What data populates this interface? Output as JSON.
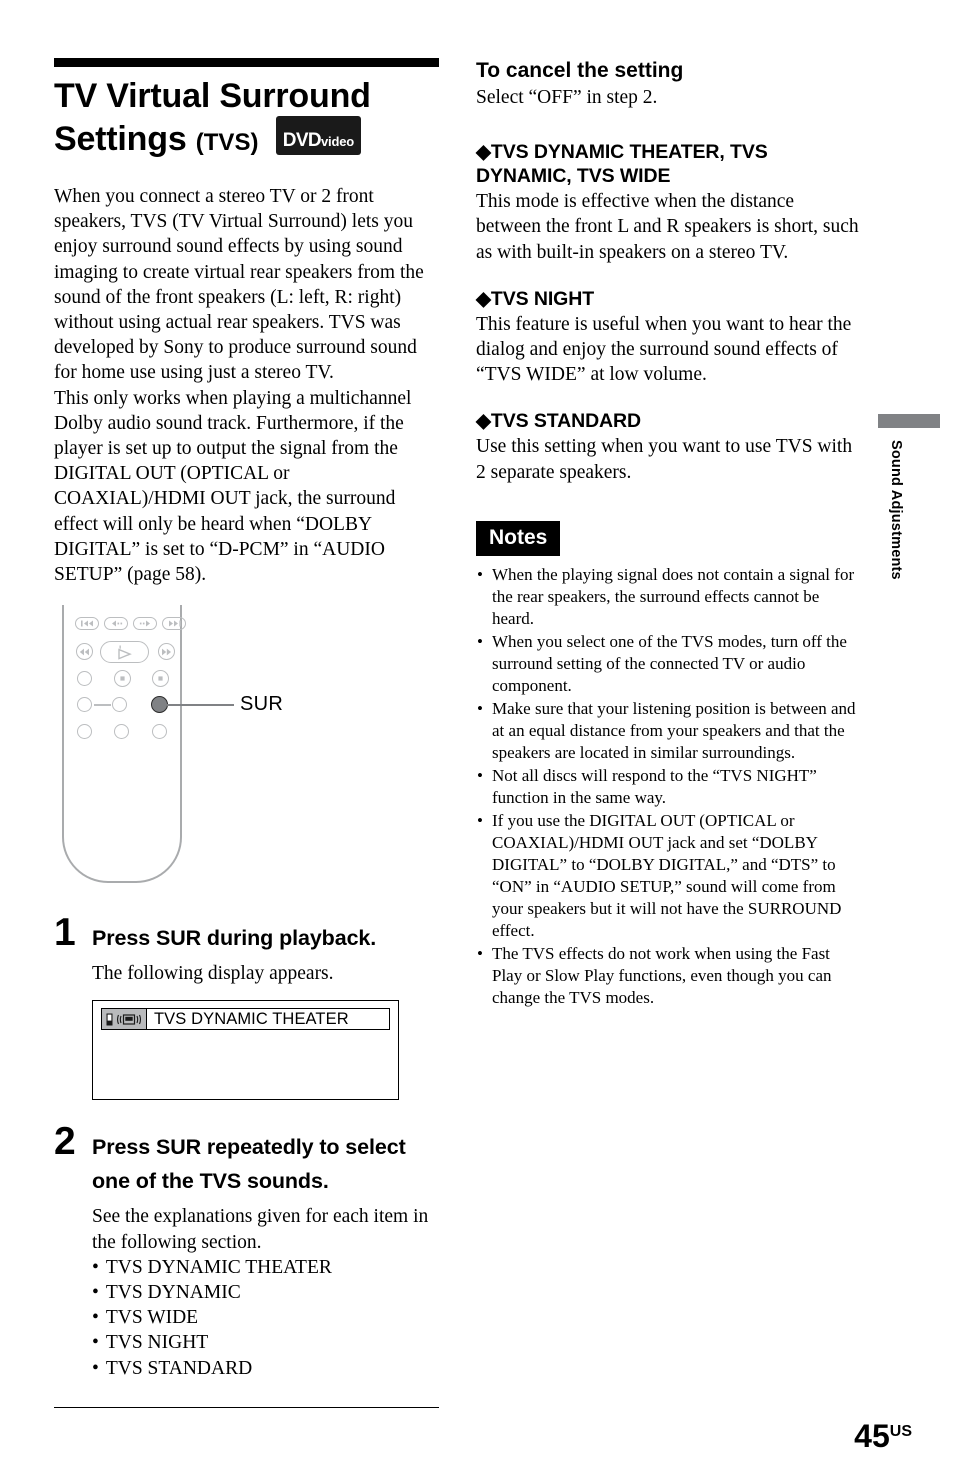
{
  "header": {
    "title_line1": "TV Virtual Surround",
    "title_line2": "Settings",
    "title_abbrev": "(TVS)",
    "logo_primary": "DVD",
    "logo_secondary": "video"
  },
  "intro": {
    "paragraph1": "When you connect a stereo TV or 2 front speakers, TVS (TV Virtual Surround) lets you enjoy surround sound effects by using sound imaging to create virtual rear speakers from the sound of the front speakers (L: left, R: right) without using actual rear speakers. TVS was developed by Sony to produce surround sound for home use using just a stereo TV.",
    "paragraph2": "This only works when playing a multichannel Dolby audio sound track. Furthermore, if the player is set up to output the signal from the DIGITAL OUT (OPTICAL or COAXIAL)/HDMI OUT jack, the surround effect will only be heard when “DOLBY DIGITAL” is set to “D-PCM” in “AUDIO SETUP” (page 58)."
  },
  "remote": {
    "callout_label": "SUR",
    "buttons": [
      "prev-track-button",
      "step-reverse-button",
      "step-forward-button",
      "next-track-button",
      "rewind-button",
      "play-button",
      "fast-forward-button",
      "blank-button-1",
      "pause-button",
      "stop-button",
      "blank-button-2",
      "blank-button-3",
      "sur-button",
      "blank-button-4",
      "blank-button-5",
      "blank-button-6"
    ]
  },
  "steps": [
    {
      "number": "1",
      "heading": "Press SUR during playback.",
      "subtext": "The following display appears.",
      "display": {
        "text": "TVS DYNAMIC THEATER",
        "icons": [
          "battery-icon",
          "surround-speaker-icon"
        ]
      }
    },
    {
      "number": "2",
      "heading": "Press SUR repeatedly to select one of the TVS sounds.",
      "subtext": "See the explanations given for each item in the following section.",
      "items": [
        "TVS DYNAMIC THEATER",
        "TVS DYNAMIC",
        "TVS WIDE",
        "TVS NIGHT",
        "TVS STANDARD"
      ]
    }
  ],
  "right": {
    "cancel_heading": "To cancel the setting",
    "cancel_body": "Select “OFF” in step 2.",
    "sections": [
      {
        "heading": "◆TVS DYNAMIC THEATER, TVS DYNAMIC, TVS WIDE",
        "body": "This mode is effective when the distance between the front L and R speakers is short, such as with built-in speakers on a stereo TV."
      },
      {
        "heading": "◆TVS NIGHT",
        "body": "This feature is useful when you want to hear the dialog and enjoy the surround sound effects of “TVS WIDE” at low volume."
      },
      {
        "heading": "◆TVS STANDARD",
        "body": "Use this setting when you want to use TVS with 2 separate speakers."
      }
    ],
    "notes_label": "Notes",
    "notes": [
      "When the playing signal does not contain a signal for the rear speakers, the surround effects cannot be heard.",
      "When you select one of the TVS modes, turn off the surround setting of the connected TV or audio component.",
      "Make sure that your listening position is between and at an equal distance from your speakers and that the speakers are located in similar surroundings.",
      "Not all discs will respond to the “TVS NIGHT” function in the same way.",
      "If you use the DIGITAL OUT (OPTICAL or COAXIAL)/HDMI OUT jack and set “DOLBY DIGITAL” to “DOLBY DIGITAL,” and “DTS” to “ON” in “AUDIO SETUP,” sound will come from your speakers but it will not have the SURROUND effect.",
      "The TVS effects do not work when using the Fast Play or Slow Play functions, even though you can change the TVS modes."
    ]
  },
  "side_tab": {
    "label": "Sound Adjustments"
  },
  "footer": {
    "page_number": "45",
    "page_suffix": "US"
  },
  "colors": {
    "accent_gray": "#808285",
    "outline_gray": "#bcbec0",
    "black": "#000000"
  }
}
